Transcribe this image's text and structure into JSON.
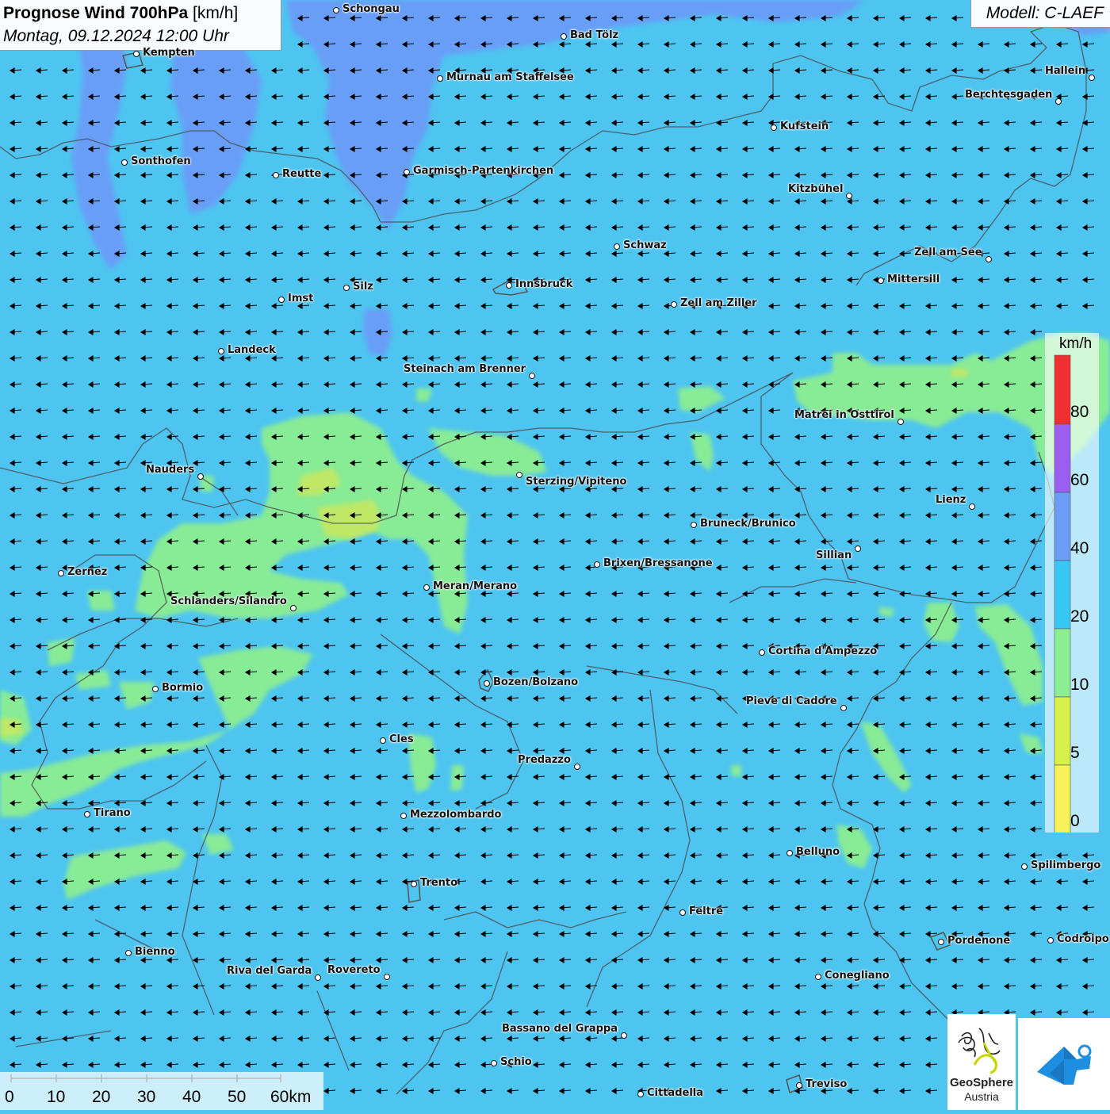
{
  "header": {
    "title_bold": "Prognose Wind 700hPa",
    "title_unit": "[km/h]",
    "datetime": "Montag, 09.12.2024 12:00 Uhr",
    "model": "Modell: C-LAEF"
  },
  "legend": {
    "title": "km/h",
    "levels": [
      "80",
      "60",
      "40",
      "20",
      "10",
      "5",
      "0"
    ],
    "colors": {
      "0-5": "#f8f25a",
      "5-10": "#d8f04a",
      "10-20": "#8cee92",
      "20-40": "#38c8f4",
      "40-60": "#6a9cf8",
      "60-80": "#9a5ef0",
      "80+": "#f03030"
    }
  },
  "scalebar": {
    "labels": [
      "0",
      "10",
      "20",
      "30",
      "40",
      "50",
      "60km"
    ]
  },
  "logos": {
    "geosphere_line1": "GeoSphere",
    "geosphere_line2": "Austria",
    "geosphere_icon": "geosphere-logo-icon",
    "app_icon": "warning-app-icon"
  },
  "wind": {
    "direction": "from east",
    "typical_speed_kmh": "20-40"
  },
  "cities": [
    {
      "name": "Schongau"
    },
    {
      "name": "Bad Tölz"
    },
    {
      "name": "Kempten"
    },
    {
      "name": "Murnau am Staffelsee"
    },
    {
      "name": "Hallein"
    },
    {
      "name": "Berchtesgaden"
    },
    {
      "name": "Kufstein"
    },
    {
      "name": "Sonthofen"
    },
    {
      "name": "Reutte"
    },
    {
      "name": "Garmisch-Partenkirchen"
    },
    {
      "name": "Kitzbühel"
    },
    {
      "name": "Schwaz"
    },
    {
      "name": "Zell am See"
    },
    {
      "name": "Mittersill"
    },
    {
      "name": "Innsbruck"
    },
    {
      "name": "Silz"
    },
    {
      "name": "Imst"
    },
    {
      "name": "Zell am Ziller"
    },
    {
      "name": "Landeck"
    },
    {
      "name": "Steinach am Brenner"
    },
    {
      "name": "Matrei in Osttirol"
    },
    {
      "name": "Nauders"
    },
    {
      "name": "Sterzing/Vipiteno"
    },
    {
      "name": "Lienz"
    },
    {
      "name": "Bruneck/Brunico"
    },
    {
      "name": "Sillian"
    },
    {
      "name": "Zernez"
    },
    {
      "name": "Brixen/Bressanone"
    },
    {
      "name": "Meran/Merano"
    },
    {
      "name": "Schlanders/Silandro"
    },
    {
      "name": "Cortina d'Ampezzo"
    },
    {
      "name": "Bozen/Bolzano"
    },
    {
      "name": "Bormio"
    },
    {
      "name": "Pieve di Cadore"
    },
    {
      "name": "Cles"
    },
    {
      "name": "Predazzo"
    },
    {
      "name": "Tirano"
    },
    {
      "name": "Mezzolombardo"
    },
    {
      "name": "Belluno"
    },
    {
      "name": "Spilimbergo"
    },
    {
      "name": "Trento"
    },
    {
      "name": "Feltre"
    },
    {
      "name": "Pordenone"
    },
    {
      "name": "Codroipo"
    },
    {
      "name": "Bienno"
    },
    {
      "name": "Riva del Garda"
    },
    {
      "name": "Rovereto"
    },
    {
      "name": "Conegliano"
    },
    {
      "name": "Bassano del Grappa"
    },
    {
      "name": "Schio"
    },
    {
      "name": "Treviso"
    },
    {
      "name": "Cittadella"
    }
  ]
}
